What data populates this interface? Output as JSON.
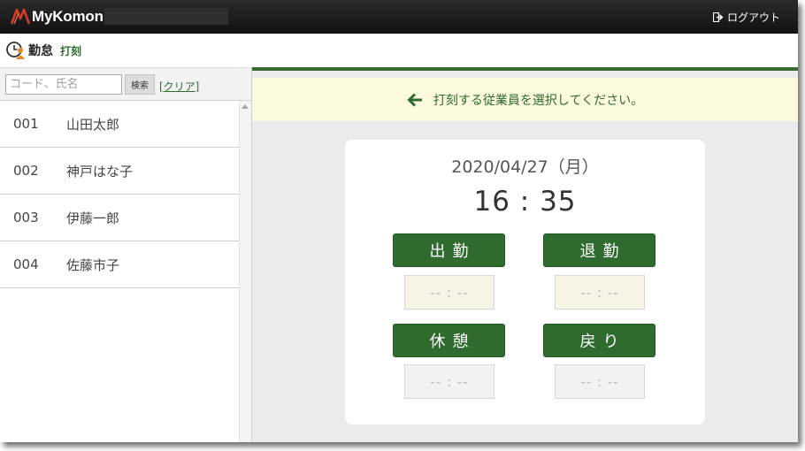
{
  "header": {
    "logo_text": "MyKomon",
    "logout_label": "ログアウト"
  },
  "title": {
    "main": "勤怠",
    "sub": "打刻"
  },
  "search": {
    "placeholder": "コード、氏名",
    "button_label": "検索",
    "clear_label": "[クリア]"
  },
  "employees": [
    {
      "code": "001",
      "name": "山田太郎"
    },
    {
      "code": "002",
      "name": "神戸はな子"
    },
    {
      "code": "003",
      "name": "伊藤一郎"
    },
    {
      "code": "004",
      "name": "佐藤市子"
    }
  ],
  "notice": {
    "text": "打刻する従業員を選択してください。"
  },
  "clock": {
    "date": "2020/04/27（月）",
    "time": "16 : 35"
  },
  "punch": {
    "clock_in": {
      "label": "出勤",
      "value": "-- : --"
    },
    "clock_out": {
      "label": "退勤",
      "value": "-- : --"
    },
    "break_start": {
      "label": "休憩",
      "value": "-- : --"
    },
    "break_end": {
      "label": "戻り",
      "value": "-- : --"
    }
  },
  "colors": {
    "accent_green": "#2f6b2f",
    "notice_bg": "#fbf9de",
    "topbar": "#1a1a1a",
    "logo_red": "#d23a2a"
  }
}
